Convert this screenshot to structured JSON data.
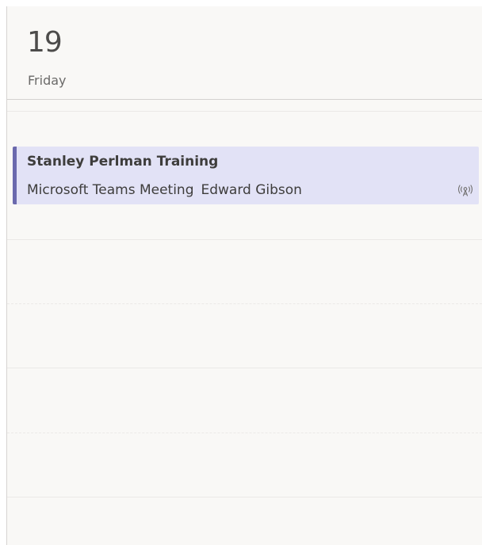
{
  "day": {
    "number": "19",
    "name": "Friday"
  },
  "event": {
    "title": "Stanley Perlman Training",
    "location": "Microsoft Teams Meeting",
    "organizer": "Edward Gibson",
    "icon": "broadcast-icon",
    "accent_color": "#6b69ad",
    "background_color": "#e2e2f6"
  }
}
